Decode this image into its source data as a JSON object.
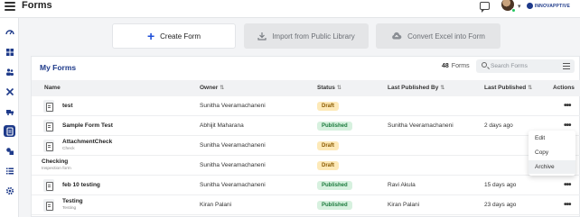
{
  "app": {
    "title": "Forms",
    "brand": "INNOVAPPTIVE"
  },
  "header": {
    "icons": [
      "hamburger-icon",
      "chat-icon",
      "avatar",
      "chevron-down-icon"
    ]
  },
  "sidebar": {
    "items": [
      {
        "icon": "gauge-icon",
        "active": false
      },
      {
        "icon": "grid-icon",
        "active": false
      },
      {
        "icon": "people-icon",
        "active": false
      },
      {
        "icon": "tools-icon",
        "active": false
      },
      {
        "icon": "truck-icon",
        "active": false
      },
      {
        "icon": "forms-icon",
        "active": true
      },
      {
        "icon": "shapes-icon",
        "active": false
      },
      {
        "icon": "list-icon",
        "active": false
      },
      {
        "icon": "gear-icon",
        "active": false
      }
    ]
  },
  "actions": {
    "create_label": "Create Form",
    "import_label": "Import from Public Library",
    "excel_label": "Convert Excel into Form"
  },
  "my_forms": {
    "title": "My Forms",
    "count": "48",
    "count_label": "Forms",
    "search_placeholder": "Search Forms"
  },
  "table": {
    "columns": {
      "name": "Name",
      "owner": "Owner",
      "status": "Status",
      "last_published_by": "Last Published By",
      "last_published": "Last Published",
      "actions": "Actions"
    },
    "sort_glyph": "⇅",
    "rows": [
      {
        "name": "test",
        "subtitle": "",
        "owner": "Sunitha Veeramachaneni",
        "status": "Draft",
        "last_published_by": "",
        "last_published": "",
        "has_icon": true
      },
      {
        "name": "Sample Form Test",
        "subtitle": "",
        "owner": "Abhijit Maharana",
        "status": "Published",
        "last_published_by": "Sunitha Veeramachaneni",
        "last_published": "2 days ago",
        "has_icon": true
      },
      {
        "name": "AttachmentCheck",
        "subtitle": "Check",
        "owner": "Sunitha Veeramachaneni",
        "status": "Draft",
        "last_published_by": "",
        "last_published": "",
        "has_icon": true
      },
      {
        "name": "Checking",
        "subtitle": "Inspection form",
        "owner": "Sunitha Veeramachaneni",
        "status": "Draft",
        "last_published_by": "",
        "last_published": "",
        "has_icon": false
      },
      {
        "name": "feb 10 testing",
        "subtitle": "",
        "owner": "Sunitha Veeramachaneni",
        "status": "Published",
        "last_published_by": "Ravi Akula",
        "last_published": "15 days ago",
        "has_icon": true
      },
      {
        "name": "Testing",
        "subtitle": "Testing",
        "owner": "Kiran Palani",
        "status": "Published",
        "last_published_by": "Kiran Palani",
        "last_published": "23 days ago",
        "has_icon": true
      }
    ]
  },
  "row_menu": {
    "items": [
      "Edit",
      "Copy",
      "Archive"
    ],
    "highlighted": "Archive"
  },
  "colors": {
    "accent": "#1e3a8a",
    "draft_bg": "#fde9b8",
    "published_bg": "#d7f1df"
  }
}
